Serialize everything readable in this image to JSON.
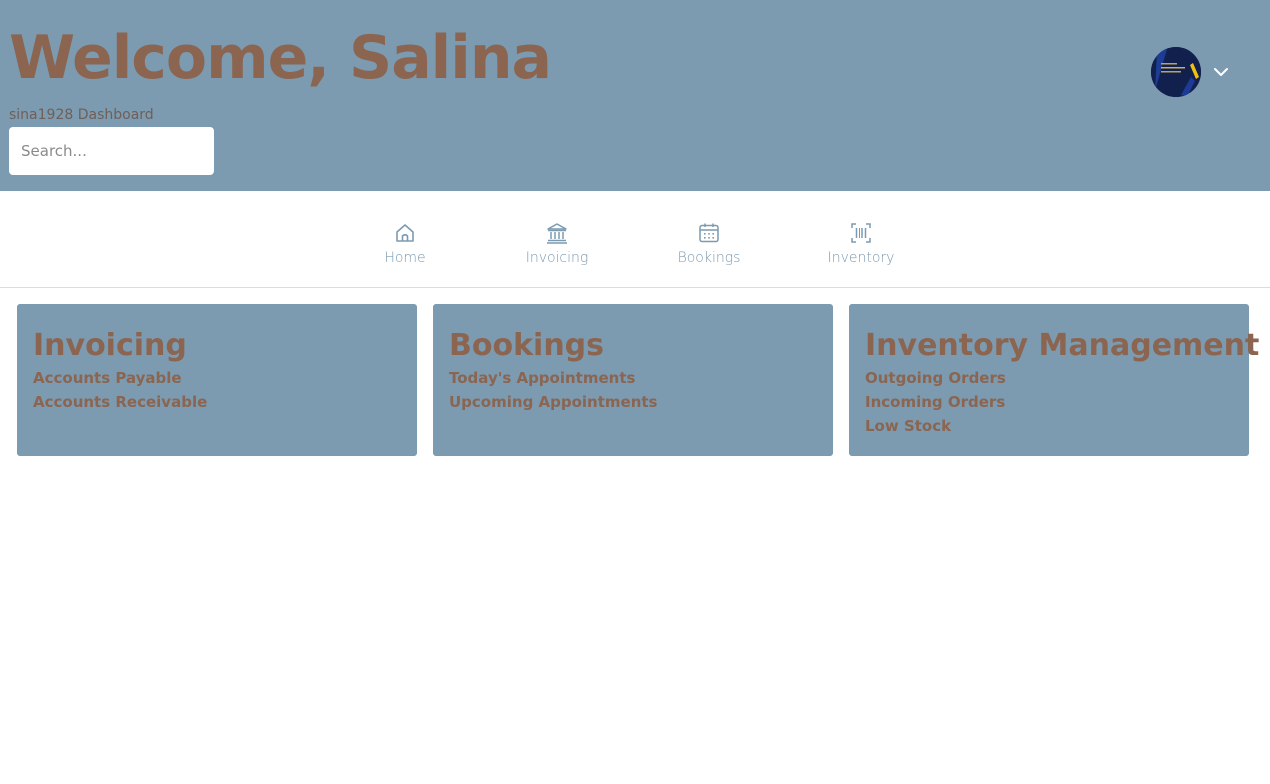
{
  "header": {
    "welcome": "Welcome, Salina",
    "subtitle": "sina1928 Dashboard",
    "search_placeholder": "Search..."
  },
  "colors": {
    "primary": "#7c9ab0",
    "accent": "#8b6550"
  },
  "nav": {
    "items": [
      {
        "label": "Home",
        "icon": "home-icon"
      },
      {
        "label": "Invoicing",
        "icon": "bank-icon"
      },
      {
        "label": "Bookings",
        "icon": "calendar-icon"
      },
      {
        "label": "Inventory",
        "icon": "barcode-icon"
      }
    ]
  },
  "cards": [
    {
      "title": "Invoicing",
      "links": [
        "Accounts Payable",
        "Accounts Receivable"
      ]
    },
    {
      "title": "Bookings",
      "links": [
        "Today's Appointments",
        "Upcoming Appointments"
      ]
    },
    {
      "title": "Inventory Management",
      "links": [
        "Outgoing Orders",
        "Incoming Orders",
        "Low Stock"
      ]
    }
  ]
}
